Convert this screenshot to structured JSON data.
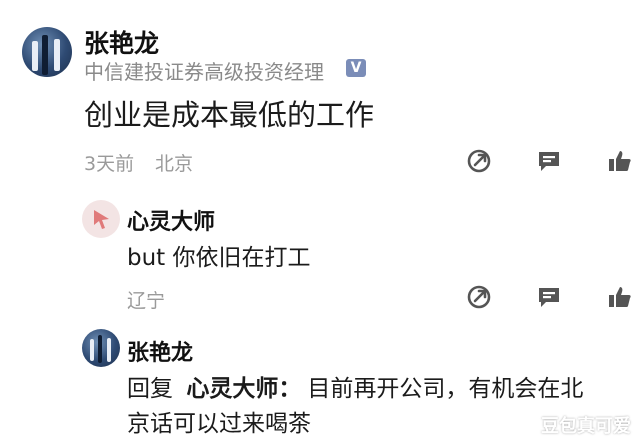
{
  "comment": {
    "author": "张艳龙",
    "author_title": "中信建投证券高级投资经理",
    "verified_badge": "V",
    "text": "创业是成本最低的工作",
    "time": "3天前",
    "location": "北京",
    "actions": [
      "share-icon",
      "reply-icon",
      "like-icon"
    ]
  },
  "replies": [
    {
      "author": "心灵大师",
      "text": "but 你依旧在打工",
      "location": "辽宁",
      "actions": [
        "share-icon",
        "reply-icon",
        "like-icon"
      ]
    },
    {
      "author": "张艳龙",
      "reply_prefix": "回复",
      "reply_target": "心灵大师：",
      "text_line1": "目前再开公司，有机会在北",
      "text_line2": "京话可以过来喝茶"
    }
  ],
  "watermark": "豆包真可爱",
  "colors": {
    "text": "#1b1b1b",
    "meta": "#9a9a9a",
    "icon": "#555555",
    "badge": "#7b8db8"
  }
}
